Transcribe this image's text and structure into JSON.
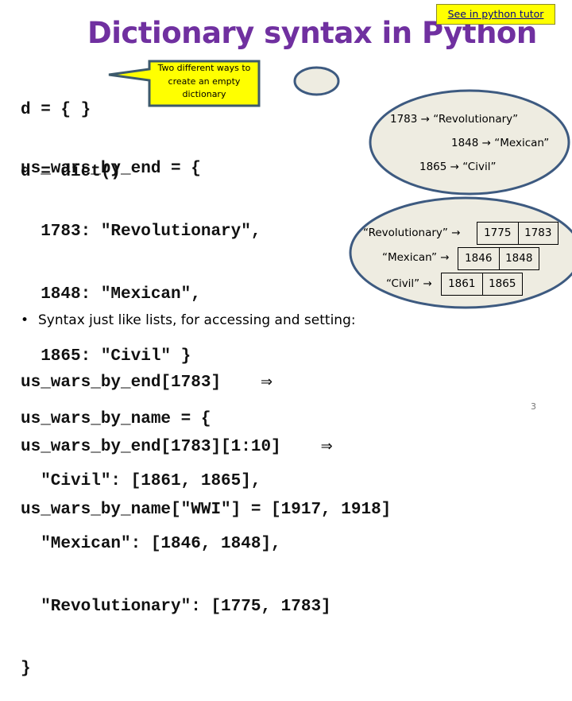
{
  "slide": {
    "title": "Dictionary syntax in Python",
    "page_number": "3",
    "link": {
      "label": "See in python tutor"
    },
    "colors": {
      "title": "#7030a0",
      "callout_fill": "#ffff00",
      "ellipse_fill": "#eeece1",
      "ellipse_stroke": "#3d5a80"
    }
  },
  "empty_dict": {
    "lines": [
      "d = { }",
      "d = dict()"
    ],
    "callout": "Two different ways to create an empty dictionary"
  },
  "code_block": {
    "lines": [
      "us_wars_by_end = {",
      "  1783: \"Revolutionary\",",
      "  1848: \"Mexican\",",
      "  1865: \"Civil\" }",
      "us_wars_by_name = {",
      "  \"Civil\": [1861, 1865],",
      "  \"Mexican\": [1846, 1848],",
      "  \"Revolutionary\": [1775, 1783]",
      "}"
    ]
  },
  "bullet": {
    "marker": "•",
    "text": "Syntax just like lists, for accessing and setting:"
  },
  "access_lines": [
    {
      "code": "us_wars_by_end[1783]",
      "arrow": "⇒"
    },
    {
      "code": "us_wars_by_end[1783][1:10]",
      "arrow": "⇒"
    },
    {
      "code": "us_wars_by_name[\"WWI\"] = [1917, 1918]",
      "arrow": ""
    }
  ],
  "by_end_diagram": {
    "entries": [
      {
        "key": "1783",
        "arrow": "→",
        "value": "“Revolutionary”"
      },
      {
        "key": "1848",
        "arrow": "→",
        "value": "“Mexican”"
      },
      {
        "key": "1865",
        "arrow": "→",
        "value": "“Civil”"
      }
    ]
  },
  "by_name_diagram": {
    "entries": [
      {
        "key": "“Revolutionary”",
        "arrow": "→",
        "values": [
          "1775",
          "1783"
        ]
      },
      {
        "key": "“Mexican”",
        "arrow": "→",
        "values": [
          "1846",
          "1848"
        ]
      },
      {
        "key": "“Civil”",
        "arrow": "→",
        "values": [
          "1861",
          "1865"
        ]
      }
    ]
  }
}
